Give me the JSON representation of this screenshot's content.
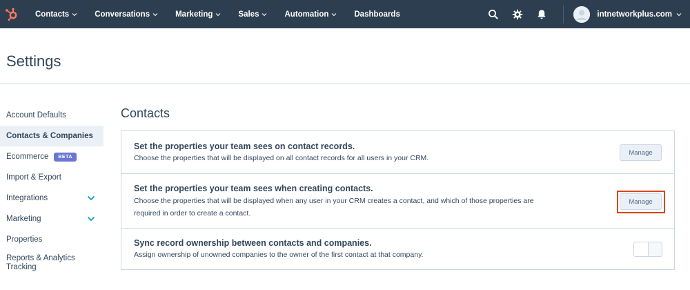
{
  "topnav": {
    "items": [
      {
        "label": "Contacts"
      },
      {
        "label": "Conversations"
      },
      {
        "label": "Marketing"
      },
      {
        "label": "Sales"
      },
      {
        "label": "Automation"
      },
      {
        "label": "Dashboards"
      }
    ],
    "account_name": "intnetworkplus.com",
    "icons": [
      "hubspot-logo",
      "search-icon",
      "gear-icon",
      "bell-icon",
      "avatar-icon"
    ],
    "background_color": "#2d3e50"
  },
  "page": {
    "title": "Settings"
  },
  "sidebar": {
    "items": [
      {
        "label": "Account Defaults"
      },
      {
        "label": "Contacts & Companies",
        "active": true
      },
      {
        "label": "Ecommerce",
        "badge": "BETA"
      },
      {
        "label": "Import & Export"
      },
      {
        "label": "Integrations",
        "expandable": true
      },
      {
        "label": "Marketing",
        "expandable": true
      },
      {
        "label": "Properties"
      },
      {
        "label": "Reports & Analytics Tracking"
      }
    ]
  },
  "main": {
    "section_title": "Contacts",
    "rows": [
      {
        "title": "Set the properties your team sees on contact records.",
        "description": "Choose the properties that will be displayed on all contact records for all users in your CRM.",
        "action_label": "Manage"
      },
      {
        "title": "Set the properties your team sees when creating contacts.",
        "description": "Choose the properties that will be displayed when any user in your CRM creates a contact, and which of those properties are required in order to create a contact.",
        "action_label": "Manage",
        "highlighted": true
      },
      {
        "title": "Sync record ownership between contacts and companies.",
        "description": "Assign ownership of unowned companies to the owner of the first contact at that company.",
        "toggle_on": false
      }
    ]
  },
  "colors": {
    "accent_highlight": "#d9441c",
    "beta_badge": "#6a78d1",
    "link_teal": "#00a4bd"
  }
}
